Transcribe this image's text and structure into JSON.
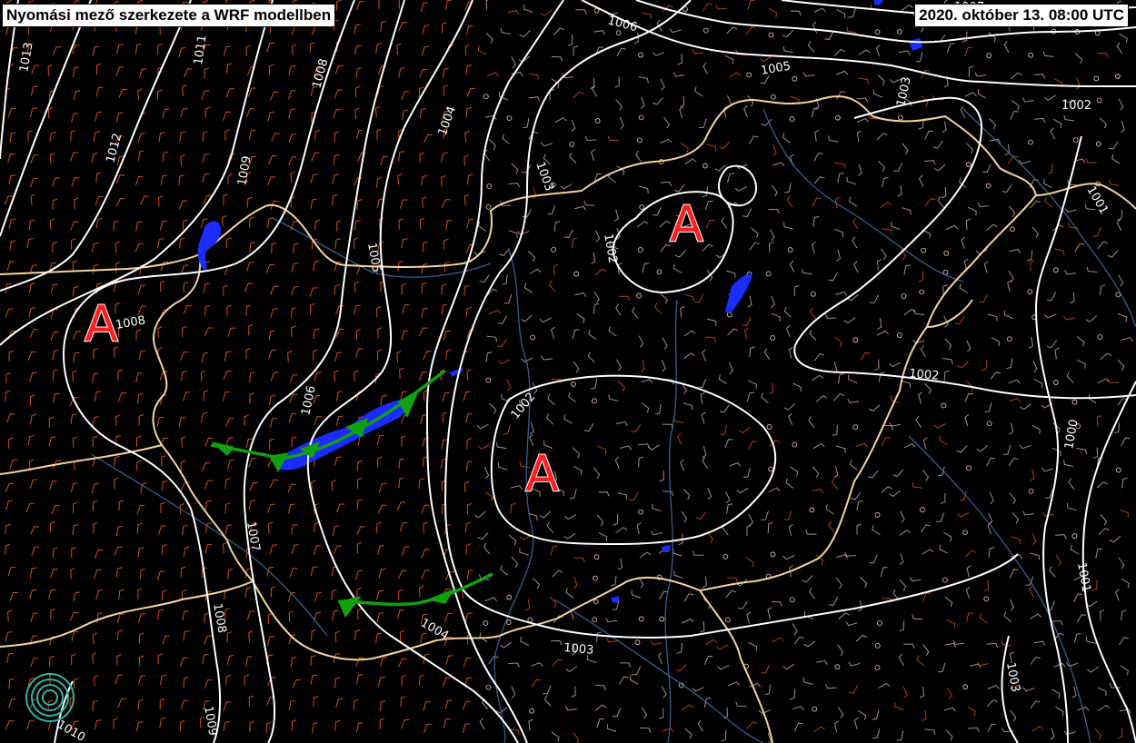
{
  "header": {
    "title": "Nyomási mező szerkezete a WRF modellben",
    "datetime": "2020. október 13. 08:00 UTC"
  },
  "pressure_centers": [
    {
      "label": "A"
    },
    {
      "label": "A"
    },
    {
      "label": "A"
    }
  ],
  "isobar_labels": [
    "1013",
    "1011",
    "1012",
    "1009",
    "1008",
    "1008",
    "1007",
    "1006",
    "1006",
    "1005",
    "1005",
    "1004",
    "1003",
    "1002",
    "1002",
    "1002",
    "1003",
    "1004",
    "1003",
    "1002",
    "1001",
    "1000",
    "1001",
    "1003",
    "1007",
    "1008",
    "1009",
    "1010"
  ],
  "colors": {
    "background": "#000000",
    "isobar": "#ffffff",
    "border": "#f5d4a0",
    "river": "#3f6fa8",
    "precip": "#1a2cff",
    "front": "#10a010",
    "high_pressure_label": "#ff1f1f",
    "wind_strong": "#ff5a1a",
    "wind_weak": "#f0c8b8"
  },
  "legend_icon": "logo-spiral-icon"
}
